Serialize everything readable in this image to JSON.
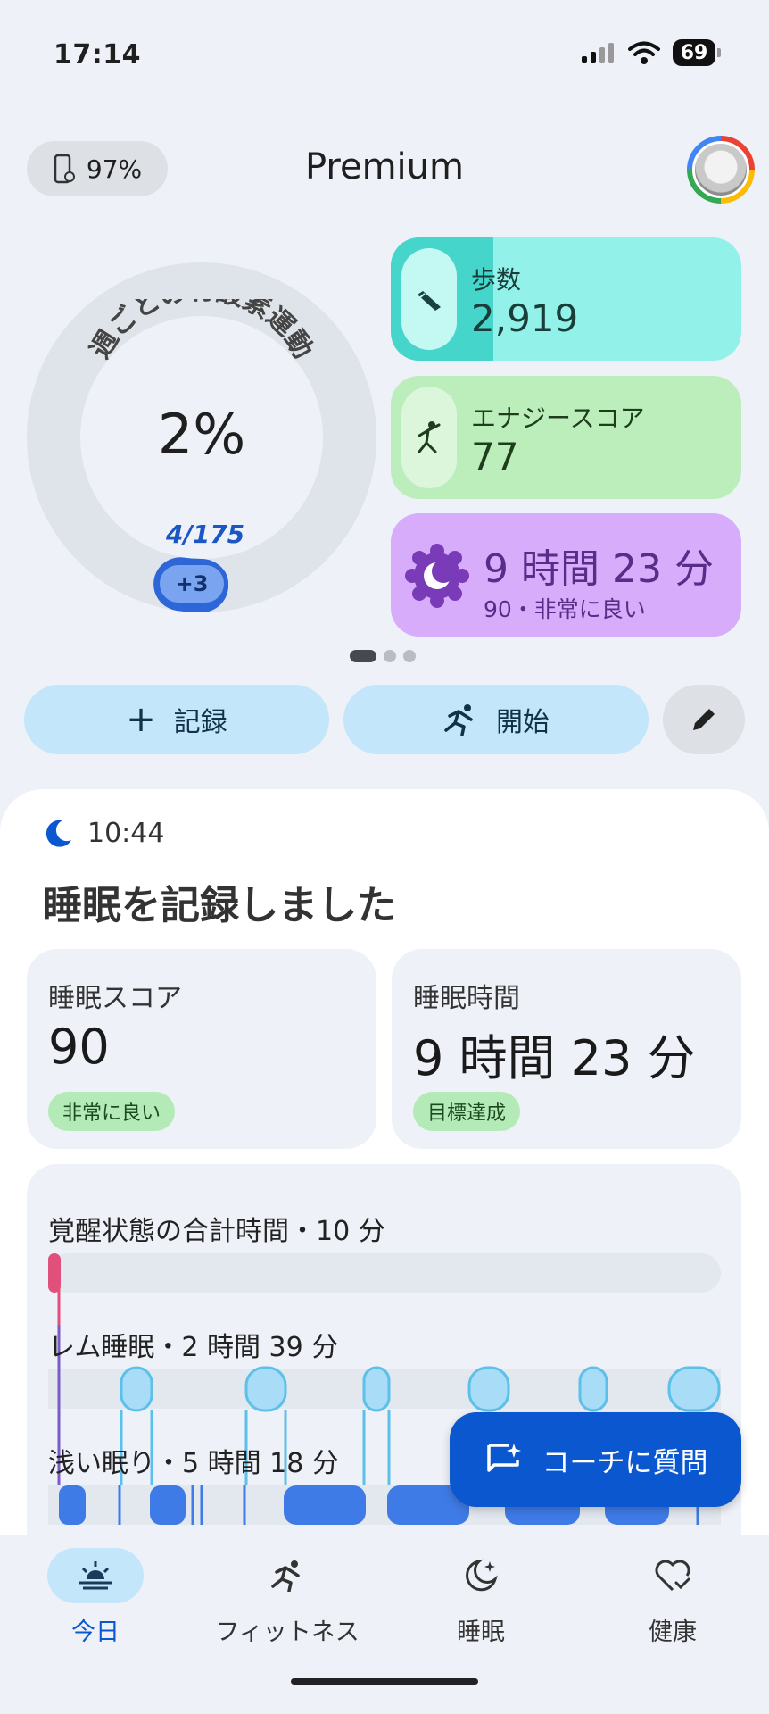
{
  "status_bar": {
    "time": "17:14",
    "battery": "69"
  },
  "header": {
    "device_battery": "97%",
    "title": "Premium"
  },
  "cardio": {
    "title": "週ごとの有酸素運動",
    "percent": "2%",
    "count": "4/175",
    "badge": "+3",
    "progress_fraction": 0.023
  },
  "metrics": {
    "steps": {
      "label": "歩数",
      "value": "2,919"
    },
    "energy": {
      "label": "エナジースコア",
      "value": "77"
    },
    "sleep": {
      "duration": "9 時間 23 分",
      "summary": "90・非常に良い"
    }
  },
  "pager": {
    "pages": 3,
    "active": 0
  },
  "actions": {
    "record_label": "記録",
    "start_label": "開始"
  },
  "sleep_panel": {
    "time": "10:44",
    "title": "睡眠を記録しました",
    "score": {
      "label": "睡眠スコア",
      "value": "90",
      "chip": "非常に良い"
    },
    "duration": {
      "label": "睡眠時間",
      "value": "9 時間 23 分",
      "chip": "目標達成"
    },
    "stages": {
      "awake": "覚醒状態の合計時間・10 分",
      "rem": "レム睡眠・2 時間 39 分",
      "light": "浅い眠り・5 時間 18 分"
    }
  },
  "fab": {
    "label": "コーチに質問"
  },
  "nav": {
    "today": "今日",
    "fitness": "フィットネス",
    "sleep": "睡眠",
    "health": "健康"
  },
  "colors": {
    "accent": "#0b57d0",
    "steps": "#45d5cb",
    "energy": "#bbeebb",
    "sleep": "#d7adfb"
  }
}
